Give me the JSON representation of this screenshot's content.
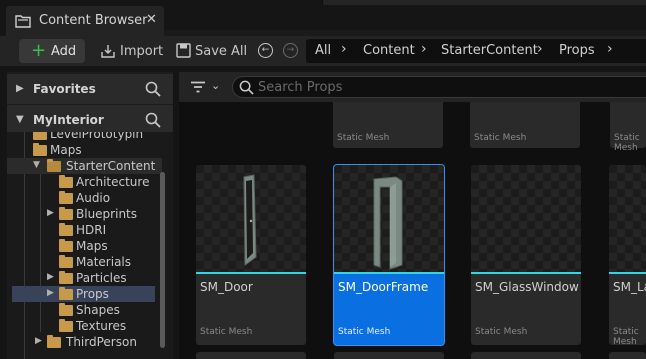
{
  "tab": {
    "title": "Content Browser",
    "close": "✕"
  },
  "toolbar": {
    "add_label": "Add",
    "import_label": "Import",
    "save_all_label": "Save All"
  },
  "breadcrumb": [
    "All",
    "Content",
    "StarterContent",
    "Props"
  ],
  "sidebar": {
    "favorites_label": "Favorites",
    "project_label": "MyInterior",
    "tree": [
      {
        "label": "LevelPrototypin",
        "depth": 1
      },
      {
        "label": "Maps",
        "depth": 1
      },
      {
        "label": "StarterContent",
        "depth": 1,
        "open": true
      },
      {
        "label": "Architecture",
        "depth": 2
      },
      {
        "label": "Audio",
        "depth": 2
      },
      {
        "label": "Blueprints",
        "depth": 2,
        "expandable": true
      },
      {
        "label": "HDRI",
        "depth": 2
      },
      {
        "label": "Maps",
        "depth": 2
      },
      {
        "label": "Materials",
        "depth": 2
      },
      {
        "label": "Particles",
        "depth": 2,
        "expandable": true
      },
      {
        "label": "Props",
        "depth": 2,
        "expandable": true,
        "selected": true
      },
      {
        "label": "Shapes",
        "depth": 2
      },
      {
        "label": "Textures",
        "depth": 2
      },
      {
        "label": "ThirdPerson",
        "depth": 1,
        "expandable": true
      }
    ]
  },
  "search": {
    "placeholder": "Search Props"
  },
  "assets_top_row": [
    "Static Mesh",
    "Static Mesh",
    "Static Mesh"
  ],
  "assets": [
    {
      "name": "SM_Door",
      "type": "Static Mesh",
      "selected": false
    },
    {
      "name": "SM_DoorFrame",
      "type": "Static Mesh",
      "selected": true
    },
    {
      "name": "SM_GlassWindow",
      "type": "Static Mesh",
      "selected": false
    },
    {
      "name": "SM_La",
      "type": "Static Mesh",
      "selected": false
    }
  ],
  "colors": {
    "accent": "#0a6fe0",
    "thumb_strip": "#2ed8e6",
    "add_plus": "#36c24a",
    "folder": "#c79a4b"
  }
}
